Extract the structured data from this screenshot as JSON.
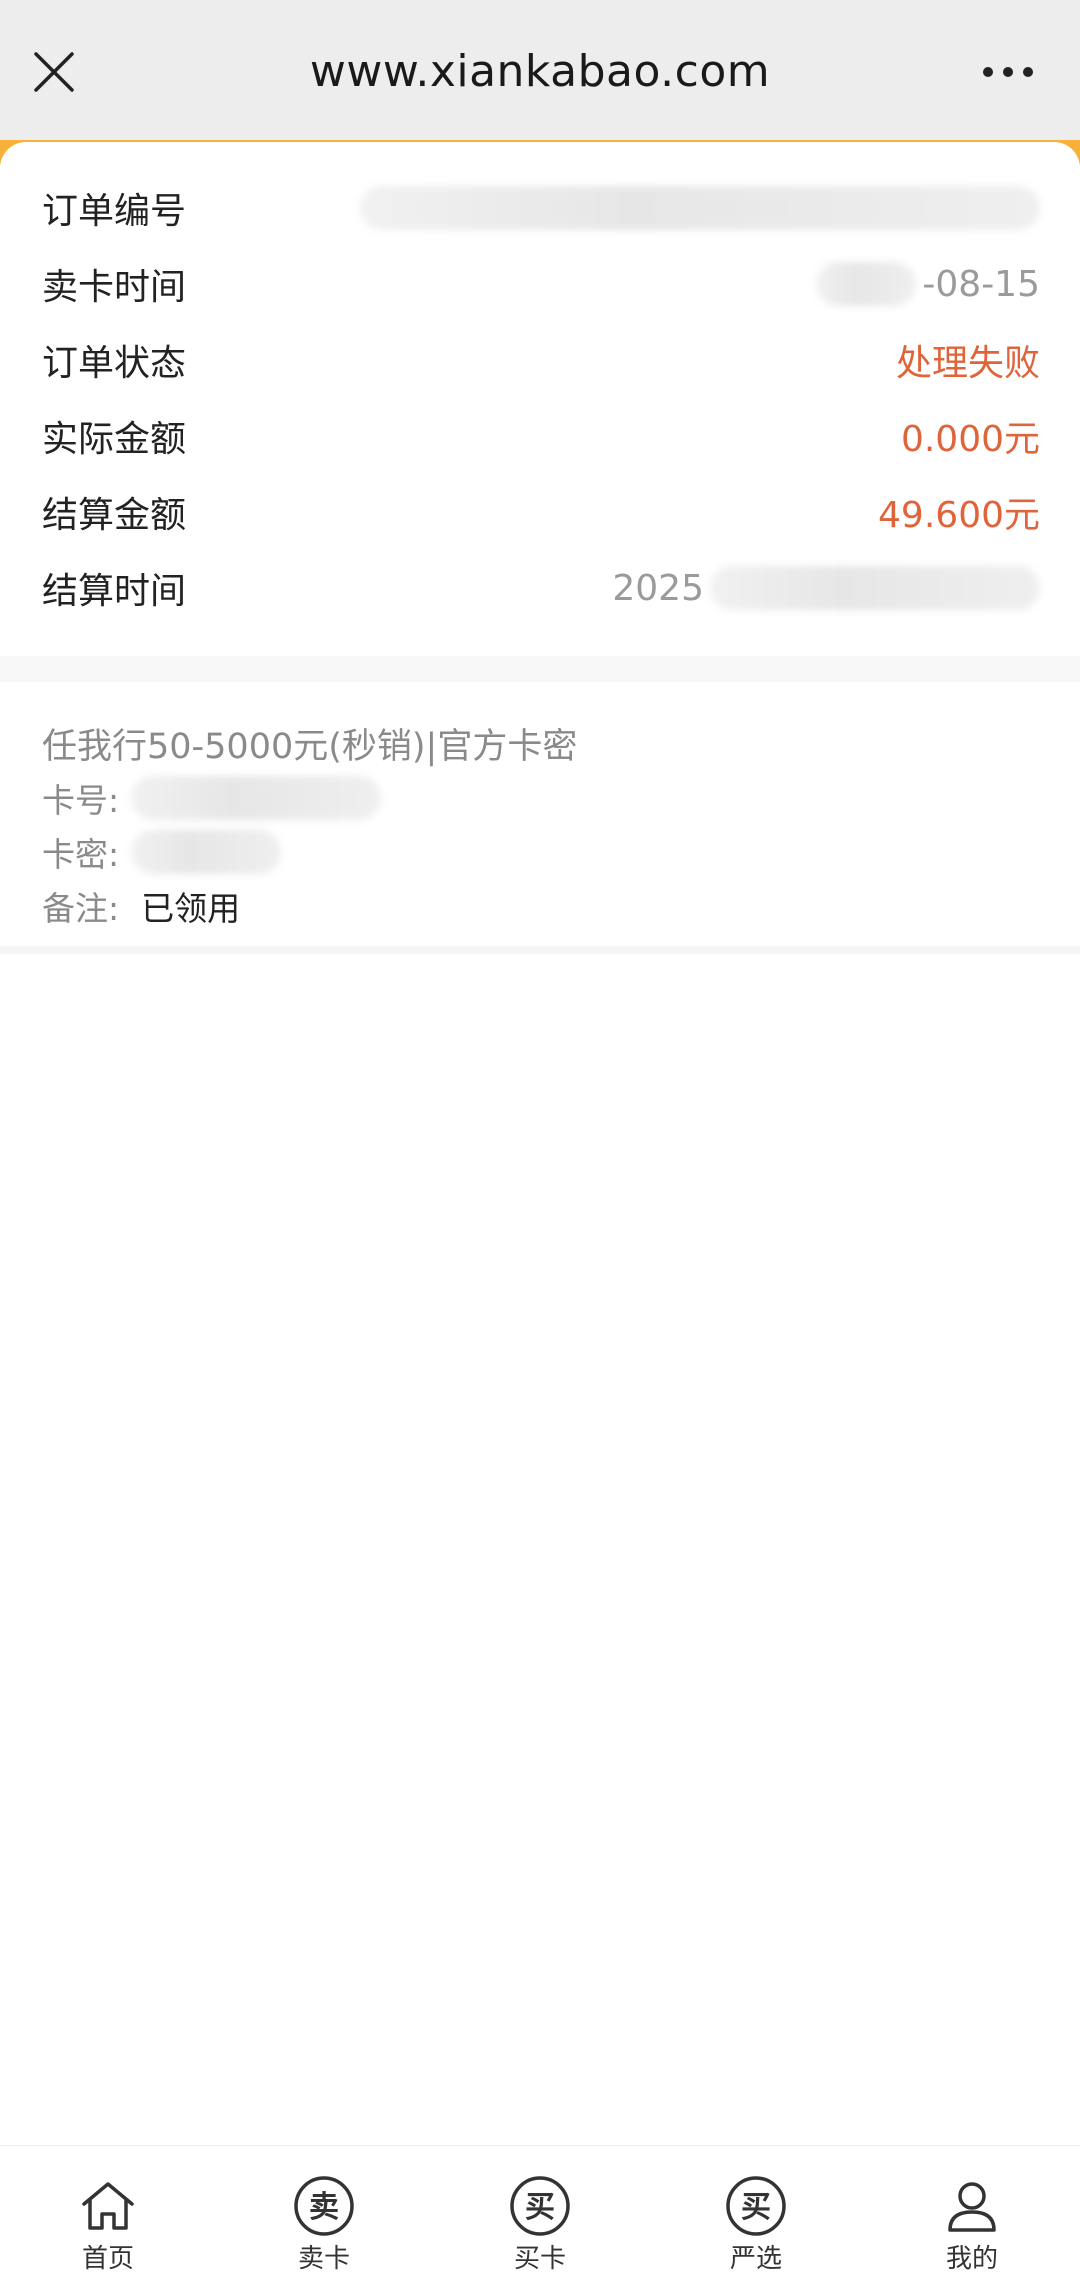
{
  "browser": {
    "url": "www.xiankabao.com",
    "close_icon": "close-icon",
    "more_icon": "more-dots-icon"
  },
  "order": {
    "rows": [
      {
        "label": "订单编号",
        "value": ""
      },
      {
        "label": "卖卡时间",
        "value": "-08-15"
      },
      {
        "label": "订单状态",
        "value": "处理失败"
      },
      {
        "label": "实际金额",
        "value": "0.000元"
      },
      {
        "label": "结算金额",
        "value": "49.600元"
      },
      {
        "label": "结算时间",
        "value": "2025"
      }
    ]
  },
  "card_info": {
    "title": "任我行50-5000元(秒销)|官方卡密",
    "card_no_label": "卡号:",
    "card_pwd_label": "卡密:",
    "remark_label": "备注:",
    "remark_value": "已领用"
  },
  "tabbar": {
    "items": [
      {
        "label": "首页",
        "icon": "home-icon"
      },
      {
        "label": "卖卡",
        "icon": "sell-card-icon",
        "glyph": "卖"
      },
      {
        "label": "买卡",
        "icon": "buy-card-icon",
        "glyph": "买"
      },
      {
        "label": "严选",
        "icon": "selected-icon",
        "glyph": "买"
      },
      {
        "label": "我的",
        "icon": "profile-icon"
      }
    ]
  },
  "colors": {
    "accent": "#f7b13a",
    "status_red": "#e0643a"
  }
}
